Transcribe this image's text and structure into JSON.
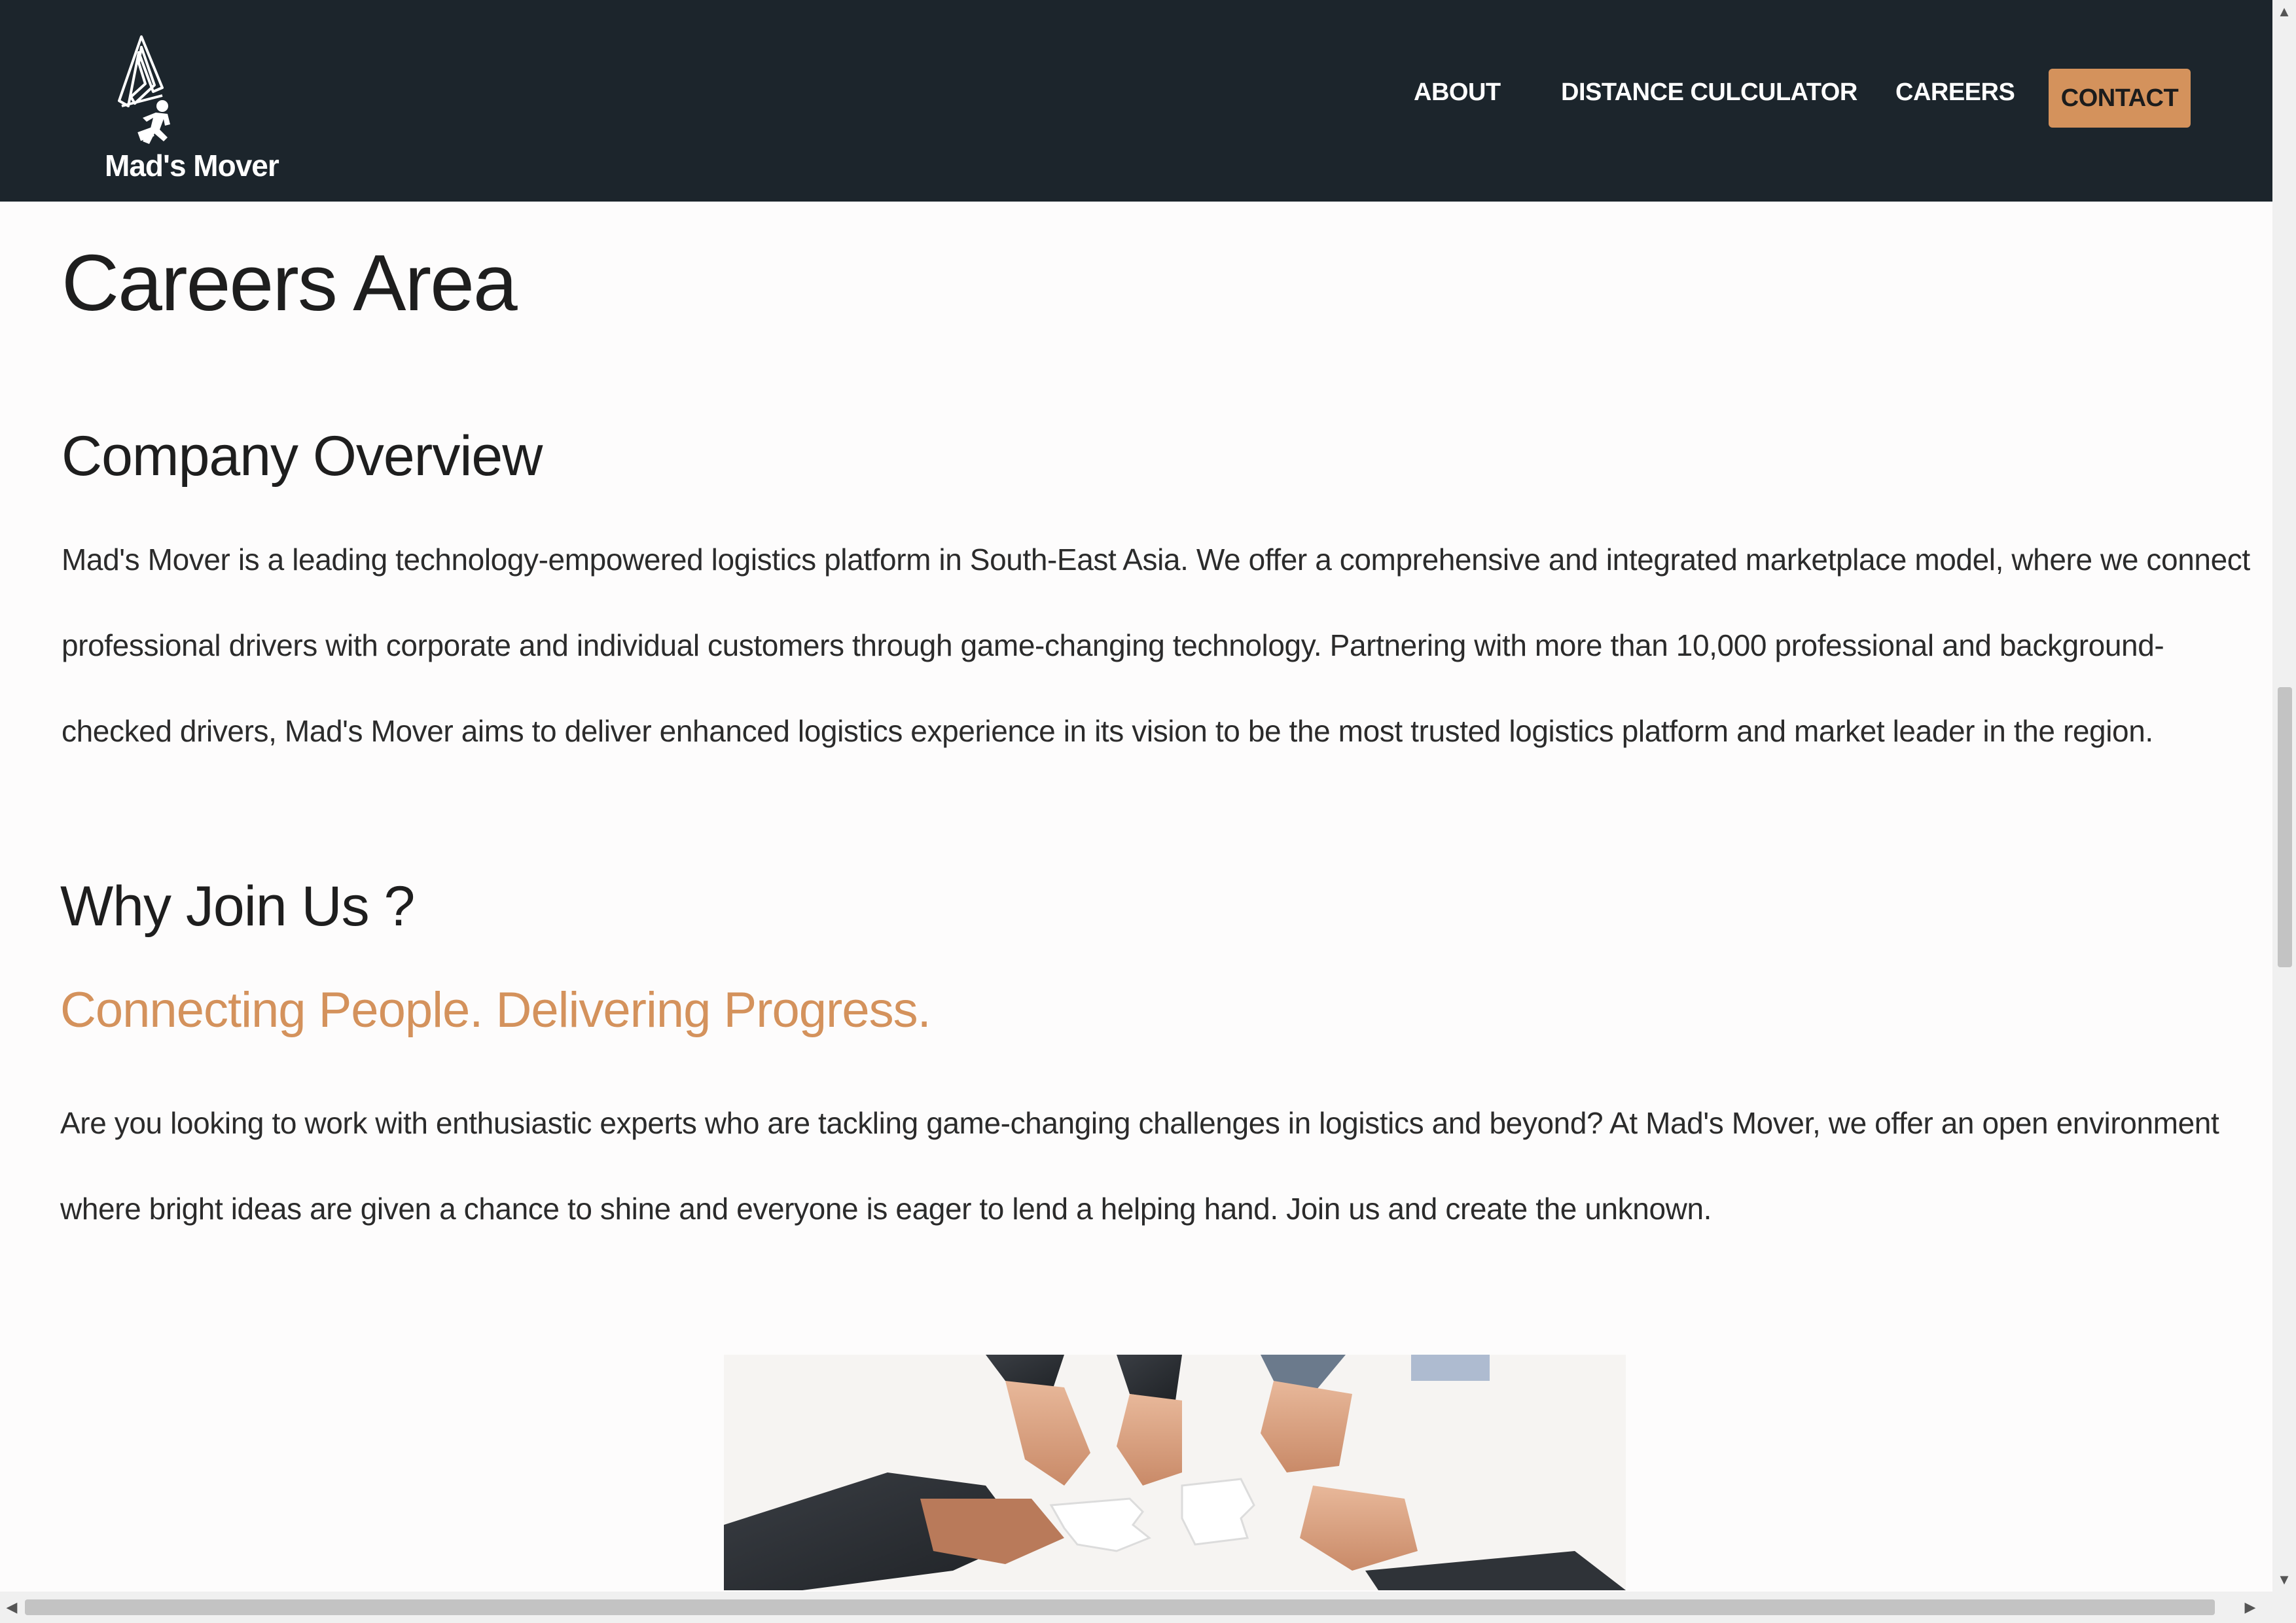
{
  "brand": {
    "name": "Mad's Mover",
    "logo_icon": "mover-logo-icon"
  },
  "nav": {
    "items": [
      {
        "label": "ABOUT"
      },
      {
        "label": "DISTANCE CULCULATOR"
      },
      {
        "label": "CAREERS"
      }
    ],
    "contact_label": "CONTACT",
    "accent_color": "#d4925c",
    "bar_color": "#1c252c"
  },
  "page": {
    "title": "Careers Area"
  },
  "overview": {
    "heading": "Company Overview",
    "lines": [
      "Mad's Mover is a leading technology-empowered logistics platform in South-East Asia. We offer a comprehensive and integrated marketplace model, where we connect",
      "professional drivers with corporate and individual customers through game-changing technology. Partnering with more than 10,000 professional and background-",
      "checked drivers, Mad's Mover aims to deliver enhanced logistics experience in its vision to be the most trusted logistics platform and market leader in the region."
    ]
  },
  "why_join": {
    "heading": "Why Join Us ?",
    "tagline": "Connecting People. Delivering Progress.",
    "lines": [
      "Are you looking to work with enthusiastic experts who are tackling game-changing challenges in logistics and beyond? At Mad's Mover, we offer an open environment",
      "where bright ideas are given a chance to shine and everyone is eager to lend a helping hand. Join us and create the unknown."
    ]
  },
  "image": {
    "subject": "hands-puzzle-image"
  },
  "scrollbars": {
    "up_arrow": "▲",
    "down_arrow": "▼",
    "left_arrow": "◀",
    "right_arrow": "▶"
  }
}
